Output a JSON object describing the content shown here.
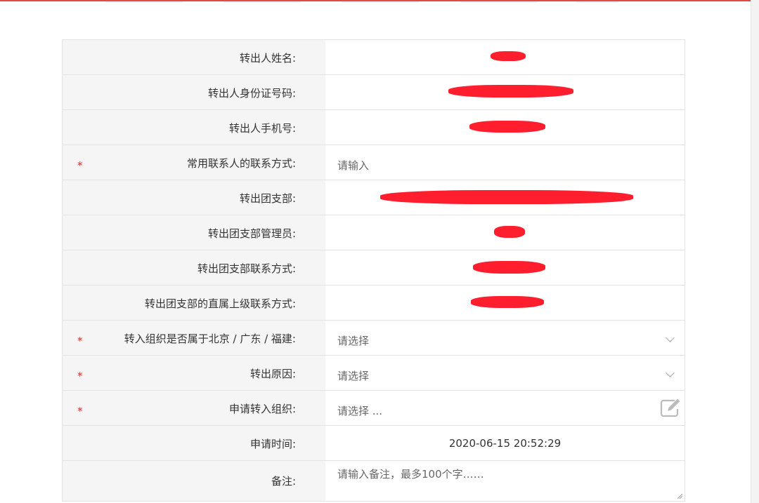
{
  "form": {
    "rows": [
      {
        "label": "转出人姓名:",
        "required": false,
        "kind": "text",
        "value": ""
      },
      {
        "label": "转出人身份证号码:",
        "required": false,
        "kind": "text",
        "value": ""
      },
      {
        "label": "转出人手机号:",
        "required": false,
        "kind": "text",
        "value": ""
      },
      {
        "label": "常用联系人的联系方式:",
        "required": true,
        "kind": "input",
        "placeholder": "请输入"
      },
      {
        "label": "转出团支部:",
        "required": false,
        "kind": "text",
        "value": ""
      },
      {
        "label": "转出团支部管理员:",
        "required": false,
        "kind": "text",
        "value": ""
      },
      {
        "label": "转出团支部联系方式:",
        "required": false,
        "kind": "text",
        "value": ""
      },
      {
        "label": "转出团支部的直属上级联系方式:",
        "required": false,
        "kind": "text",
        "value": ""
      },
      {
        "label": "转入组织是否属于北京 / 广东 / 福建:",
        "required": true,
        "kind": "select",
        "placeholder": "请选择"
      },
      {
        "label": "转出原因:",
        "required": true,
        "kind": "select",
        "placeholder": "请选择"
      },
      {
        "label": "申请转入组织:",
        "required": true,
        "kind": "picker",
        "placeholder": "请选择 ..."
      },
      {
        "label": "申请时间:",
        "required": false,
        "kind": "text",
        "value": "2020-06-15 20:52:29"
      },
      {
        "label": "备注:",
        "required": false,
        "kind": "textarea",
        "placeholder": "请输入备注，最多100个字……"
      }
    ],
    "required_mark": "*"
  },
  "icons": {
    "edit": "edit-icon",
    "dropdown": "chevron-down-icon"
  },
  "colors": {
    "accent": "#e14b44",
    "required": "#e02828",
    "redaction": "#ff1e2e",
    "label_bg": "#f5f5f5",
    "border": "#e3e3e3"
  }
}
